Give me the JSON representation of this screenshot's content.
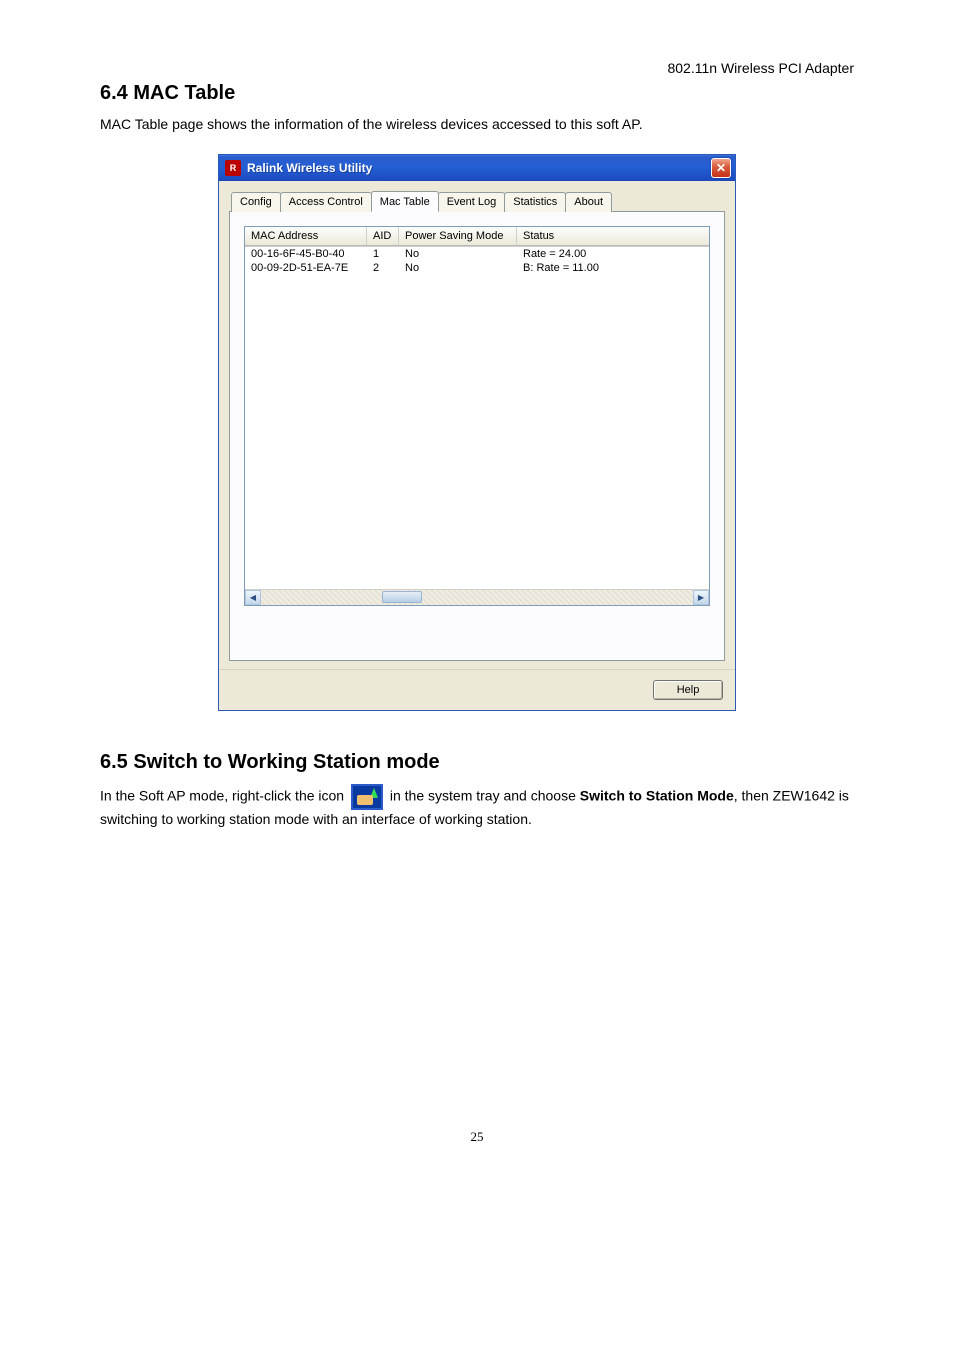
{
  "doc": {
    "header": "802.11n Wireless PCI Adapter",
    "section_64_title": "6.4 MAC Table",
    "section_64_intro": "MAC Table page shows the information of the wireless devices accessed to this soft AP.",
    "section_65_title": "6.5 Switch to Working Station mode",
    "section_65_p1_a": "In the Soft AP mode, right-click the icon ",
    "section_65_p1_b": " in the system tray and choose ",
    "section_65_bold": "Switch to Station Mode",
    "section_65_p1_c": ", then ZEW1642 is switching to working station mode with an interface of working station.",
    "page_number": "25"
  },
  "dialog": {
    "title": "Ralink Wireless Utility",
    "app_icon_text": "R",
    "close_glyph": "✕",
    "tabs": [
      "Config",
      "Access Control",
      "Mac Table",
      "Event Log",
      "Statistics",
      "About"
    ],
    "active_tab_index": 2,
    "columns": {
      "mac": "MAC Address",
      "aid": "AID",
      "psm": "Power Saving Mode",
      "status": "Status"
    },
    "rows": [
      {
        "mac": "00-16-6F-45-B0-40",
        "aid": "1",
        "psm": "No",
        "status": "Rate = 24.00"
      },
      {
        "mac": "00-09-2D-51-EA-7E",
        "aid": "2",
        "psm": "No",
        "status": "B: Rate = 11.00"
      }
    ],
    "scroll_left_glyph": "◀",
    "scroll_right_glyph": "▶",
    "help_label": "Help"
  }
}
